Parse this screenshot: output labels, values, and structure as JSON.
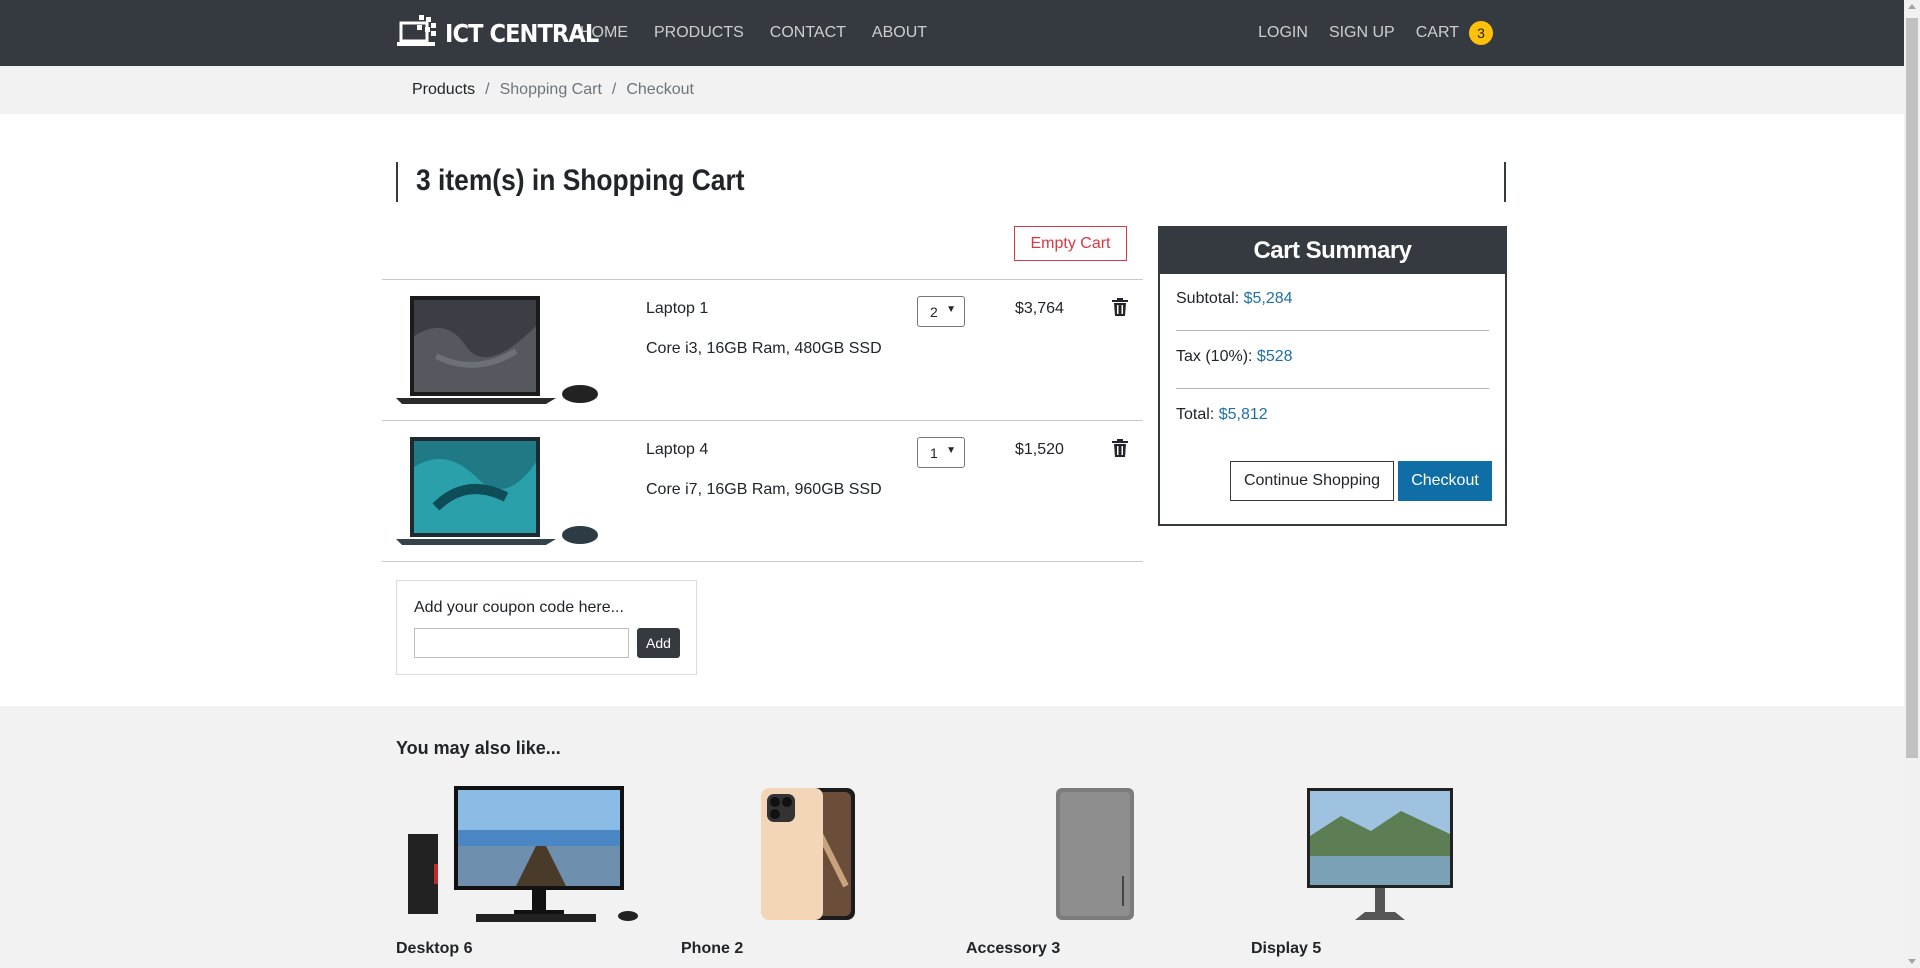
{
  "navbar": {
    "brand": "ICT CENTRAL",
    "logo_icon": "laptop-pixel-logo-icon",
    "left_links": [
      "HOME",
      "PRODUCTS",
      "CONTACT",
      "ABOUT"
    ],
    "right_links": [
      "LOGIN",
      "SIGN UP"
    ],
    "cart_label": "CART",
    "cart_count": "3",
    "colors": {
      "background": "#343a40",
      "badge": "#ffc107"
    }
  },
  "breadcrumb": [
    "Products",
    "Shopping Cart",
    "Checkout"
  ],
  "cart": {
    "title": "3 item(s) in Shopping Cart",
    "empty_button": "Empty Cart",
    "items": [
      {
        "name": "Laptop 1",
        "spec": "Core i3, 16GB Ram, 480GB SSD",
        "qty": "2",
        "price": "$3,764",
        "image_icon": "laptop-dark-image",
        "delete_icon": "trash-icon"
      },
      {
        "name": "Laptop 4",
        "spec": "Core i7, 16GB Ram, 960GB SSD",
        "qty": "1",
        "price": "$1,520",
        "image_icon": "laptop-blue-image",
        "delete_icon": "trash-icon"
      }
    ]
  },
  "coupon": {
    "label": "Add your coupon code here...",
    "value": "",
    "button": "Add"
  },
  "summary": {
    "title": "Cart Summary",
    "subtotal_label": "Subtotal:",
    "subtotal_value": "$5,284",
    "tax_label": "Tax (10%):",
    "tax_value": "$528",
    "total_label": "Total:",
    "total_value": "$5,812",
    "continue_button": "Continue Shopping",
    "checkout_button": "Checkout",
    "colors": {
      "value": "#1f6fa6",
      "checkout": "#0f6ea5"
    }
  },
  "recommendations": {
    "title": "You may also like...",
    "items": [
      {
        "name": "Desktop 6",
        "image_icon": "desktop-pc-image"
      },
      {
        "name": "Phone 2",
        "image_icon": "phone-image"
      },
      {
        "name": "Accessory 3",
        "image_icon": "power-bank-image"
      },
      {
        "name": "Display 5",
        "image_icon": "monitor-image"
      }
    ]
  }
}
